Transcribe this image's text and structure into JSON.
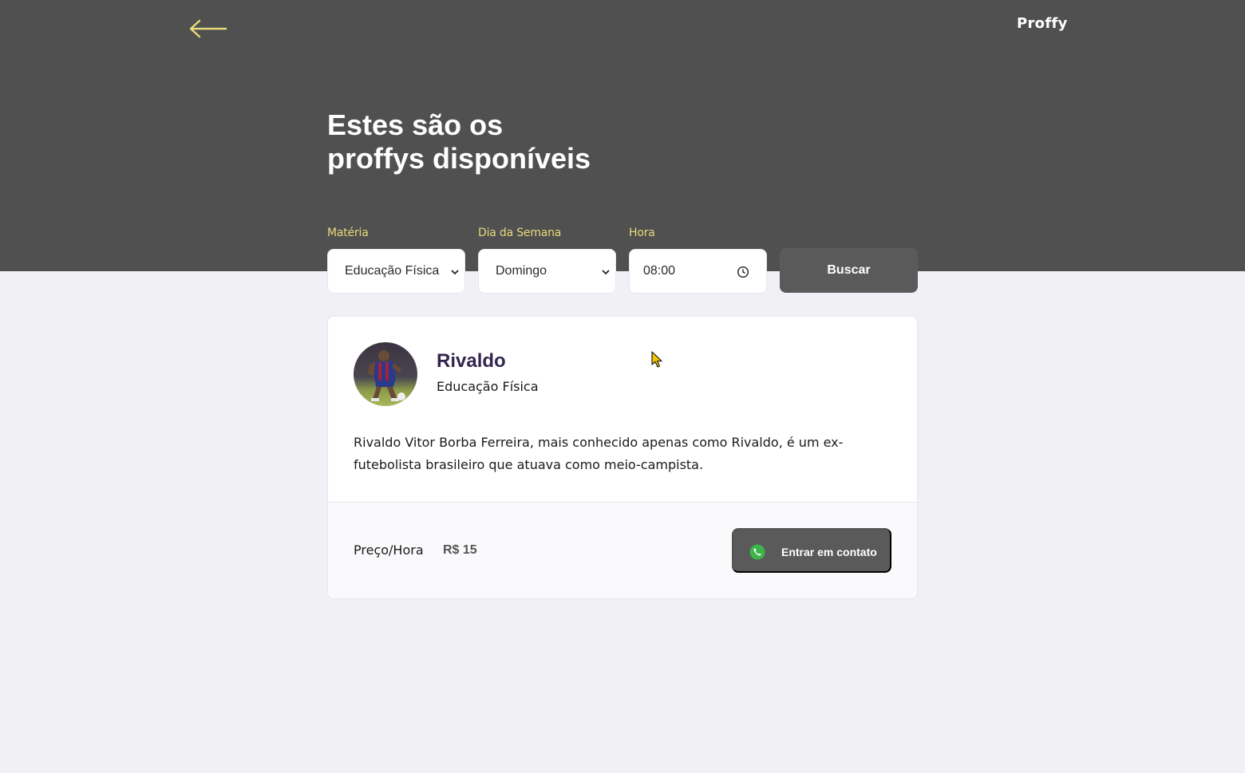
{
  "header": {
    "logo": "Proffy",
    "title_line1": "Estes são os",
    "title_line2": "proffys disponíveis"
  },
  "filters": {
    "subject": {
      "label": "Matéria",
      "value": "Educação Física"
    },
    "weekday": {
      "label": "Dia da Semana",
      "value": "Domingo"
    },
    "time": {
      "label": "Hora",
      "value": "08:00"
    },
    "search_label": "Buscar"
  },
  "teacher": {
    "name": "Rivaldo",
    "subject": "Educação Física",
    "bio": "Rivaldo Vitor Borba Ferreira, mais conhecido apenas como Rivaldo, é um ex-futebolista brasileiro que atuava como meio-campista.",
    "price_label": "Preço/Hora",
    "price_value": "R$ 15",
    "contact_label": "Entrar em contato"
  },
  "colors": {
    "header_bg": "#505050",
    "page_bg": "#f0f0f5",
    "accent_yellow": "#e8d97a",
    "button_bg": "#5a5a5a",
    "name_color": "#32264d",
    "whatsapp_green": "#3cb54a"
  }
}
